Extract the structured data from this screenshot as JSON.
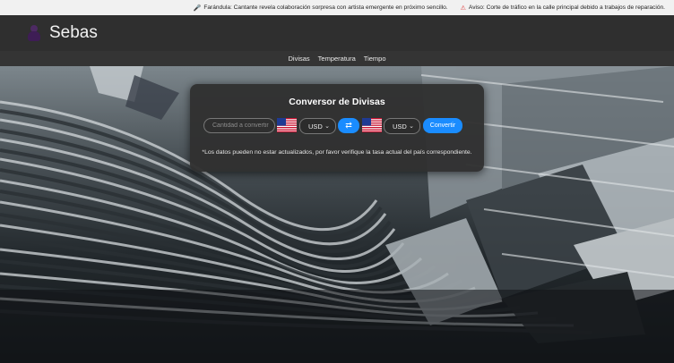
{
  "ticker": {
    "items": [
      {
        "icon": "microphone-icon",
        "text": "Farándula: Cantante revela colaboración sorpresa con artista emergente en próximo sencillo."
      },
      {
        "icon": "alert-icon",
        "text": "Aviso: Corte de tráfico en la calle principal debido a trabajos de reparación."
      }
    ]
  },
  "header": {
    "brand": "Sebas",
    "logo_icon": "user-silhouette-icon"
  },
  "nav": {
    "items": [
      "Divisas",
      "Temperatura",
      "Tiempo"
    ]
  },
  "converter": {
    "title": "Conversor de Divisas",
    "amount_placeholder": "Cantidad a convertir",
    "from_currency": "USD",
    "from_flag": "us-flag-icon",
    "swap_label": "⇄",
    "to_currency": "USD",
    "to_flag": "us-flag-icon",
    "convert_label": "Convertir",
    "note": "*Los datos pueden no estar actualizados, por favor verifique la tasa actual del país correspondiente."
  },
  "colors": {
    "accent": "#1a8cff",
    "header_bg": "#2f2f2f",
    "nav_bg": "#343434",
    "card_bg": "#303030"
  }
}
